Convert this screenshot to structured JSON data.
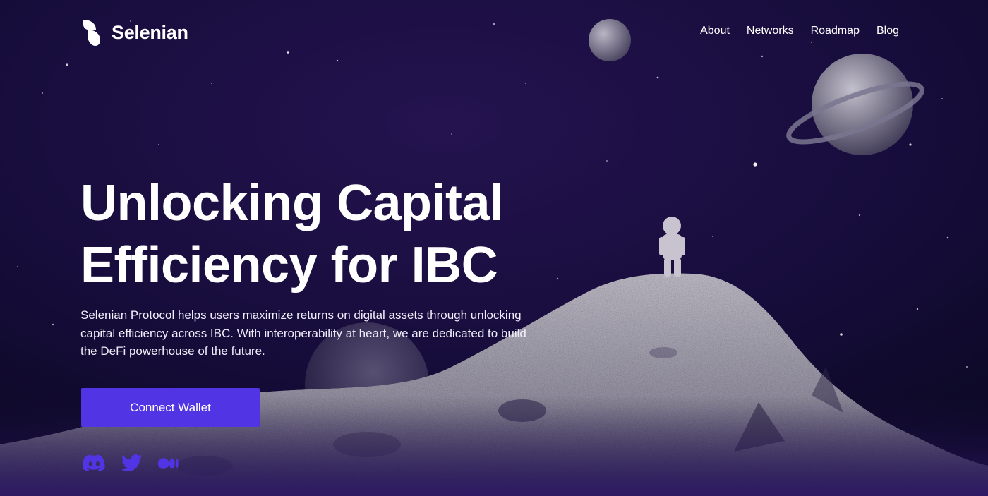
{
  "brand": {
    "name": "Selenian",
    "logo_icon": "selenian-logo-icon"
  },
  "nav": {
    "items": [
      {
        "label": "About"
      },
      {
        "label": "Networks"
      },
      {
        "label": "Roadmap"
      },
      {
        "label": "Blog"
      }
    ]
  },
  "hero": {
    "title_line1": "Unlocking Capital",
    "title_line2": "Efficiency for IBC",
    "description": "Selenian Protocol helps users maximize returns on digital assets through unlocking capital efficiency across IBC. With interoperability at heart, we are dedicated to build the DeFi powerhouse of the future.",
    "cta_label": "Connect Wallet"
  },
  "socials": [
    {
      "icon": "discord-icon"
    },
    {
      "icon": "twitter-icon"
    },
    {
      "icon": "medium-icon"
    }
  ],
  "colors": {
    "background": "#1a0f3d",
    "accent": "#5134e3",
    "social_icon": "#5134e3",
    "moon_surface": "#a8a5b4"
  }
}
